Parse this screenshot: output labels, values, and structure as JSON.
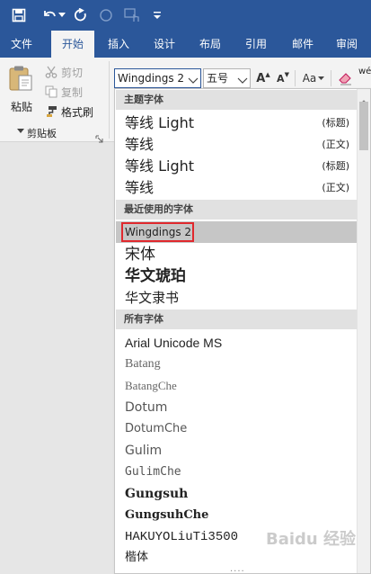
{
  "ribbon": {
    "tabs": [
      {
        "label": "文件",
        "active": false
      },
      {
        "label": "开始",
        "active": true
      },
      {
        "label": "插入",
        "active": false
      },
      {
        "label": "设计",
        "active": false
      },
      {
        "label": "布局",
        "active": false
      },
      {
        "label": "引用",
        "active": false
      },
      {
        "label": "邮件",
        "active": false
      },
      {
        "label": "审阅",
        "active": false
      }
    ],
    "clipboard": {
      "paste": "粘贴",
      "cut": "剪切",
      "copy": "复制",
      "format_painter": "格式刷",
      "group_label": "剪贴板"
    },
    "font_name": "Wingdings 2",
    "font_size": "五号",
    "grow_font": "A",
    "shrink_font": "A",
    "change_case": "Aa",
    "clear_format_partial": "wé"
  },
  "dropdown": {
    "theme_header": "主题字体",
    "theme_fonts": [
      {
        "name": "等线 Light",
        "tag": "(标题)"
      },
      {
        "name": "等线",
        "tag": "(正文)"
      },
      {
        "name": "等线 Light",
        "tag": "(标题)"
      },
      {
        "name": "等线",
        "tag": "(正文)"
      }
    ],
    "recent_header": "最近使用的字体",
    "recent_fonts": [
      "Wingdings 2",
      "宋体",
      "华文琥珀",
      "华文隶书"
    ],
    "all_header": "所有字体",
    "all_fonts": [
      "Arial Unicode MS",
      "Batang",
      "BatangChe",
      "Dotum",
      "DotumChe",
      "Gulim",
      "GulimChe",
      "Gungsuh",
      "GungsuhChe",
      "HAKUYOLiuTi3500",
      "楷体"
    ]
  },
  "watermark": "Baidu 经验",
  "colors": {
    "title_bar": "#2b579a",
    "ribbon": "#f3f3f3",
    "selected_row": "#c6c6c6",
    "highlight_box": "#e0282d"
  }
}
